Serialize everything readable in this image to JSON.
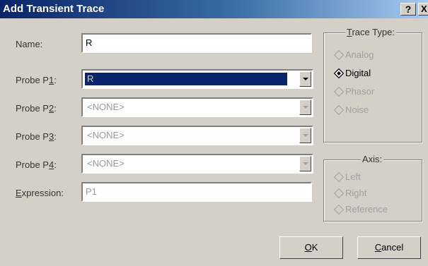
{
  "window": {
    "title": "Add Transient Trace",
    "help_label": "?",
    "close_label": "X"
  },
  "form": {
    "name": {
      "label": "Name:",
      "value": "R"
    },
    "probe_p1": {
      "label_pre": "Probe P",
      "label_key": "1",
      "label_post": ":",
      "value": "R"
    },
    "probe_p2": {
      "label_pre": "Probe P",
      "label_key": "2",
      "label_post": ":",
      "value": "<NONE>"
    },
    "probe_p3": {
      "label_pre": "Probe P",
      "label_key": "3",
      "label_post": ":",
      "value": "<NONE>"
    },
    "probe_p4": {
      "label_pre": "Probe P",
      "label_key": "4",
      "label_post": ":",
      "value": "<NONE>"
    },
    "expression": {
      "label_key": "E",
      "label_rest": "xpression:",
      "value": "P1"
    }
  },
  "trace_type": {
    "title_key": "T",
    "title_rest": "race Type:",
    "options": [
      {
        "label": "Analog",
        "checked": false,
        "enabled": false
      },
      {
        "label": "Digital",
        "checked": true,
        "enabled": true
      },
      {
        "label": "Phasor",
        "checked": false,
        "enabled": false
      },
      {
        "label": "Noise",
        "checked": false,
        "enabled": false
      }
    ]
  },
  "axis": {
    "title": "Axis:",
    "options": [
      {
        "label": "Left",
        "enabled": false
      },
      {
        "label": "Right",
        "enabled": false
      },
      {
        "label": "Reference",
        "enabled": false
      }
    ]
  },
  "buttons": {
    "ok_key": "O",
    "ok_rest": "K",
    "cancel_key": "C",
    "cancel_rest": "ancel"
  },
  "colors": {
    "titlebar": "#0a246a",
    "face": "#d4d0c8",
    "selection": "#0a246a"
  }
}
